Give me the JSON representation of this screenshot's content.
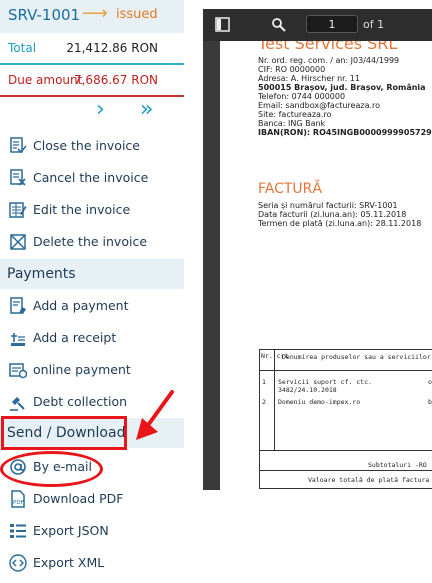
{
  "invoice": {
    "number": "SRV-1001",
    "status": "issued",
    "total_label": "Total",
    "total_value": "21,412.86 RON",
    "due_label": "Due amount",
    "due_value": "7,686.67 RON"
  },
  "nav": {
    "next": "›",
    "last": "»"
  },
  "menu": {
    "close": "Close the invoice",
    "cancel": "Cancel the invoice",
    "edit": "Edit the invoice",
    "delete": "Delete the invoice",
    "payments_header": "Payments",
    "add_payment": "Add a payment",
    "add_receipt": "Add a receipt",
    "online_payment": "online payment",
    "debt_collection": "Debt collection",
    "send_header": "Send / Download",
    "by_email": "By e-mail",
    "download_pdf": "Download PDF",
    "export_json": "Export JSON",
    "export_xml": "Export XML"
  },
  "viewer": {
    "page": "1",
    "of": "of 1"
  },
  "doc": {
    "company": "Test Services SRL",
    "line1": "Nr. ord. reg. com. / an: J03/44/1999",
    "line2": "CIF: RO 0000000",
    "line3": "Adresa: A. Hirscher nr. 11",
    "line4": "500015 Brașov, jud. Brașov, România",
    "line5": "Telefon: 0744 000000",
    "line6": "Email: sandbox@factureaza.ro",
    "line7": "Site: factureaza.ro",
    "line8": "Banca: ING Bank",
    "line9": "IBAN(RON): RO45INGB0000999905729",
    "factura": "FACTURĂ",
    "seria": "Seria și numărul facturii:  SRV-1001",
    "data": "Data facturii (zi.luna.an): 05.11.2018",
    "termen": "Termen de plată (zi.luna.an): 28.11.2018",
    "th_nr": "Nr. crt",
    "th_denumire": "Denumirea produselor sau a serviciilor",
    "r1_nr": "1",
    "r1_desc": "Servicii suport cf. ctc.",
    "r1_desc2": "3482/24.10.2018",
    "r1_um": "or",
    "r2_nr": "2",
    "r2_desc": "Domeniu demo-impex.ro",
    "r2_um": "bu",
    "subtotal": "Subtotaluri -RO",
    "total_plata": "Valoare totală de plată factura cu"
  }
}
